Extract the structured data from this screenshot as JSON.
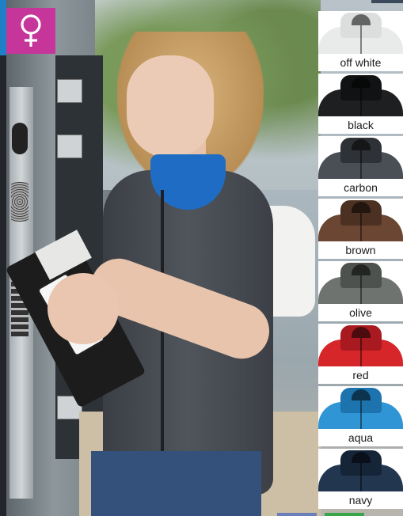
{
  "badge": {
    "icon": "female-symbol-icon",
    "color": "#c6369a"
  },
  "swatches": [
    {
      "label": "off white",
      "color": "#e9eaea",
      "collar": "#dcdede"
    },
    {
      "label": "black",
      "color": "#1d1f21",
      "collar": "#111213"
    },
    {
      "label": "carbon",
      "color": "#4a4e55",
      "collar": "#2e3136"
    },
    {
      "label": "brown",
      "color": "#6b4632",
      "collar": "#4c3123"
    },
    {
      "label": "olive",
      "color": "#6f7370",
      "collar": "#4e524f"
    },
    {
      "label": "red",
      "color": "#d6262a",
      "collar": "#a81a1f"
    },
    {
      "label": "aqua",
      "color": "#2f95d4",
      "collar": "#1c73ad"
    },
    {
      "label": "navy",
      "color": "#223650",
      "collar": "#162438"
    }
  ]
}
